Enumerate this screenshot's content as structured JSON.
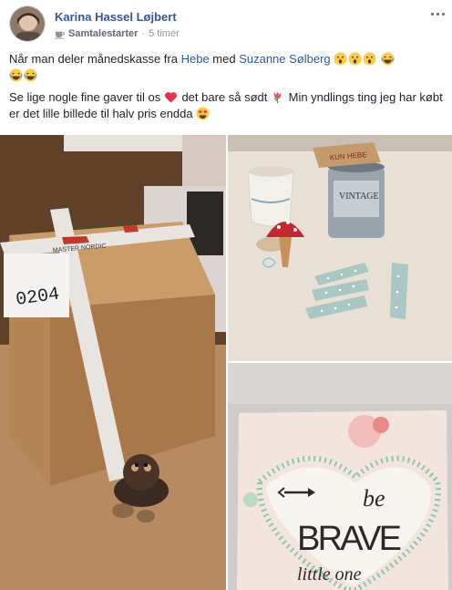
{
  "post": {
    "author": "Karina Hassel Løjbert",
    "group": "Samtalestarter",
    "separator": "·",
    "time": "5 timer",
    "line1_before": "Når man deler månedskasse fra ",
    "line1_link1": "Hebe",
    "line1_mid": " med ",
    "line1_link2": "Suzanne Sølberg",
    "line2_a": "Se lige nogle fine gaver til os ",
    "line2_b": " det bare så sødt ",
    "line2_c": " Min yndlings ting jeg har købt er det lille billede til halv pris endda "
  },
  "photos": {
    "box_label": "0204",
    "box_tape": "MASTER NORDIC",
    "tag_text": "KUN HEBE",
    "can_text": "VINTAGE",
    "sign_line1": "be",
    "sign_line2": "BRAVE",
    "sign_line3": "little one"
  },
  "icons": {
    "more": "more-icon",
    "cup": "coffee-cup-icon",
    "emoji_surprised": "surprised-face-icon",
    "emoji_laugh": "laughing-face-icon",
    "emoji_heart": "red-heart-icon",
    "emoji_tulip": "tulip-icon",
    "emoji_hearteyes": "heart-eyes-icon"
  },
  "colors": {
    "link": "#365899",
    "meta": "#90949c"
  }
}
